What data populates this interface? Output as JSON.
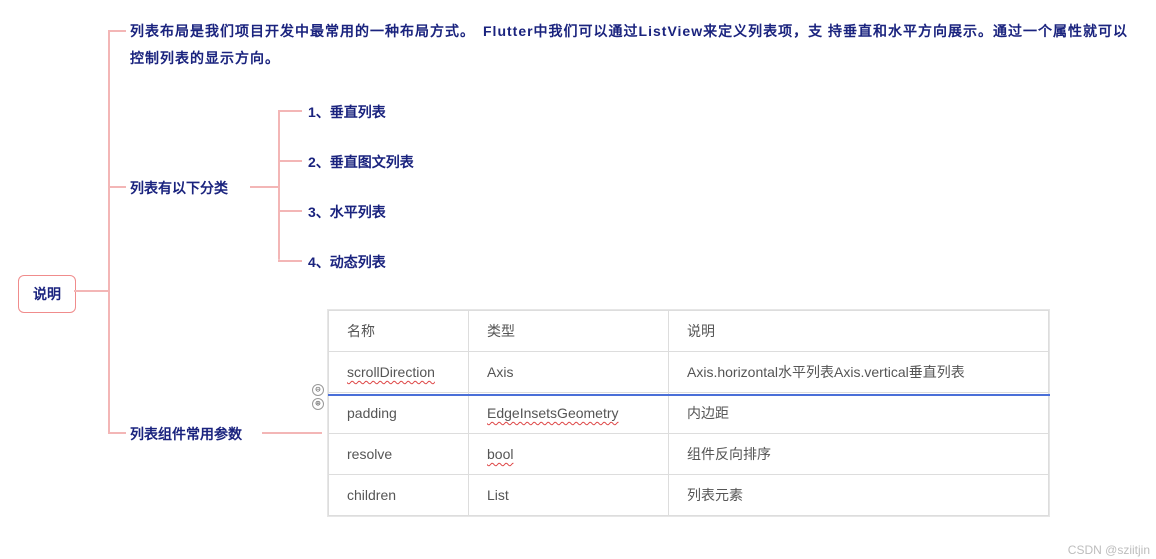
{
  "root": {
    "label": "说明"
  },
  "description": {
    "text": "列表布局是我们项目开发中最常用的一种布局方式。　Flutter中我们可以通过ListView来定义列表项，支 持垂直和水平方向展示。通过一个属性就可以控制列表的显示方向。"
  },
  "categories": {
    "label": "列表有以下分类",
    "items": [
      "1、垂直列表",
      "2、垂直图文列表",
      "3、水平列表",
      "4、动态列表"
    ]
  },
  "params": {
    "label": "列表组件常用参数",
    "headers": {
      "name": "名称",
      "type": "类型",
      "desc": "说明"
    },
    "rows": [
      {
        "name": "scrollDirection",
        "type": "Axis",
        "desc": "Axis.horizontal水平列表Axis.vertical垂直列表"
      },
      {
        "name": "padding",
        "type": "EdgeInsetsGeometry",
        "desc": "内边距"
      },
      {
        "name": "resolve",
        "type": "bool",
        "desc": "组件反向排序"
      },
      {
        "name": "children",
        "type": "List",
        "desc": "列表元素"
      }
    ]
  },
  "handles": {
    "minus": "⊖",
    "plus": "⊕"
  },
  "watermark": "CSDN @sziitjin"
}
